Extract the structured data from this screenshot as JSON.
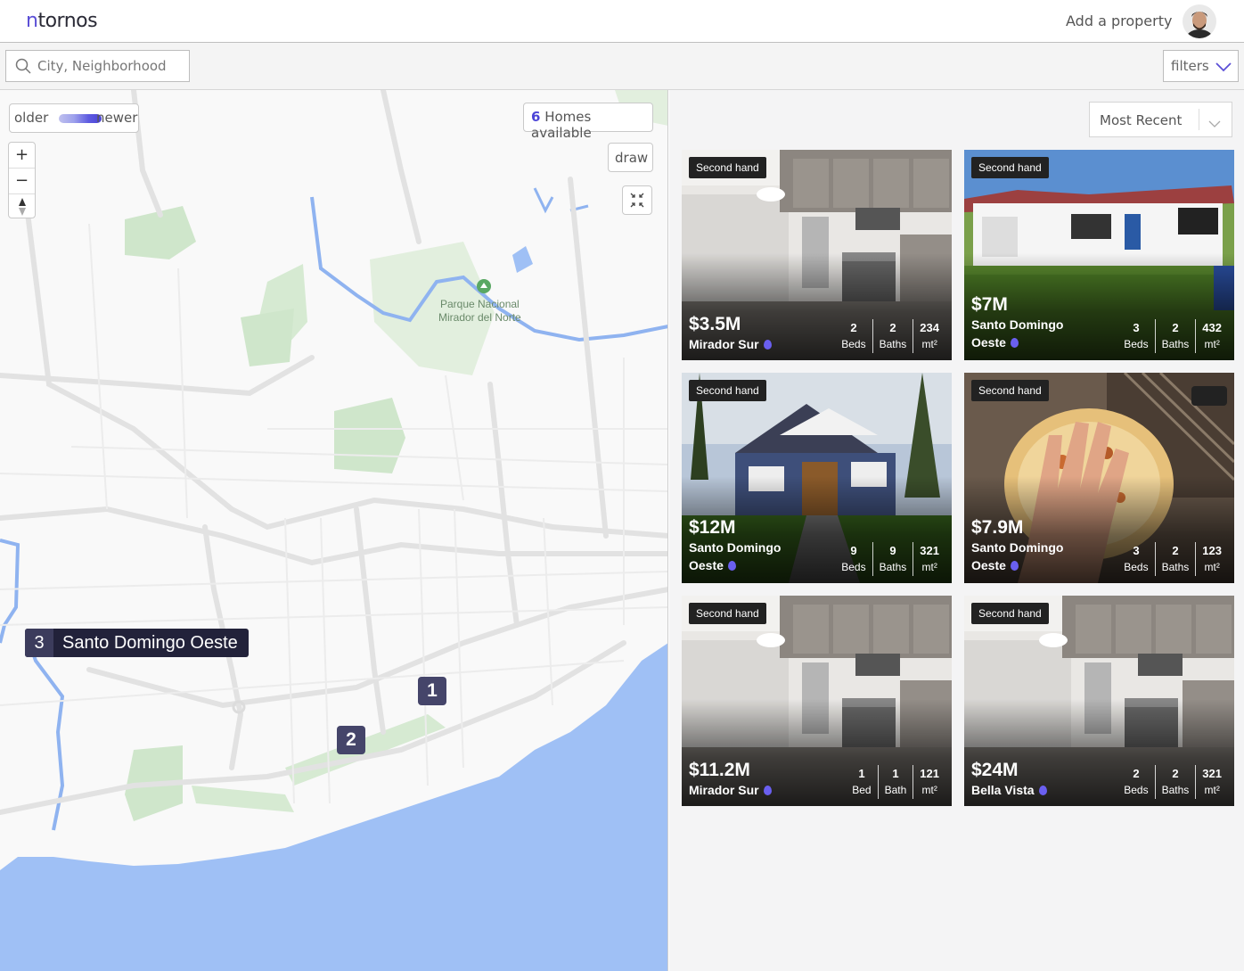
{
  "header": {
    "logo_first": "n",
    "logo_rest": "tornos",
    "add_property": "Add a property",
    "avatar_icon": "user-avatar"
  },
  "search": {
    "placeholder": "City, Neighborhood",
    "value": ""
  },
  "filters_label": "filters",
  "map": {
    "older": "older",
    "newer": "newer",
    "homes_count": "6",
    "homes_label": "Homes available",
    "draw_label": "draw",
    "zoom_in": "+",
    "zoom_out": "−",
    "park_line1": "Parque Nacional",
    "park_line2": "Mirador del Norte",
    "cluster_label": {
      "count": "3",
      "name": "Santo Domingo Oeste"
    },
    "pins": [
      "1",
      "2"
    ],
    "colors": {
      "water": "#9fc0f5",
      "park": "#cfe6cb",
      "road": "#e3e3e3",
      "pin": "#45456a"
    }
  },
  "sort": {
    "selected": "Most Recent"
  },
  "listings": [
    {
      "badge": "Second hand",
      "price": "$3.5M",
      "loc1": "Mirador Sur",
      "loc2": "",
      "beds": "2",
      "beds_label": "Beds",
      "baths": "2",
      "baths_label": "Baths",
      "area": "234",
      "area_label": "mt²",
      "image": "kitchen"
    },
    {
      "badge": "Second hand",
      "price": "$7M",
      "loc1": "Santo Domingo",
      "loc2": "Oeste",
      "beds": "3",
      "beds_label": "Beds",
      "baths": "2",
      "baths_label": "Baths",
      "area": "432",
      "area_label": "mt²",
      "image": "white-house"
    },
    {
      "badge": "Second hand",
      "price": "$12M",
      "loc1": "Santo Domingo",
      "loc2": "Oeste",
      "beds": "9",
      "beds_label": "Beds",
      "baths": "9",
      "baths_label": "Baths",
      "area": "321",
      "area_label": "mt²",
      "image": "blue-house"
    },
    {
      "badge": "Second hand",
      "price": "$7.9M",
      "loc1": "Santo Domingo",
      "loc2": "Oeste",
      "beds": "3",
      "beds_label": "Beds",
      "baths": "2",
      "baths_label": "Baths",
      "area": "123",
      "area_label": "mt²",
      "image": "pizza"
    },
    {
      "badge": "Second hand",
      "price": "$11.2M",
      "loc1": "Mirador Sur",
      "loc2": "",
      "beds": "1",
      "beds_label": "Bed",
      "baths": "1",
      "baths_label": "Bath",
      "area": "121",
      "area_label": "mt²",
      "image": "kitchen"
    },
    {
      "badge": "Second hand",
      "price": "$24M",
      "loc1": "Bella Vista",
      "loc2": "",
      "beds": "2",
      "beds_label": "Beds",
      "baths": "2",
      "baths_label": "Baths",
      "area": "321",
      "area_label": "mt²",
      "image": "kitchen"
    }
  ]
}
